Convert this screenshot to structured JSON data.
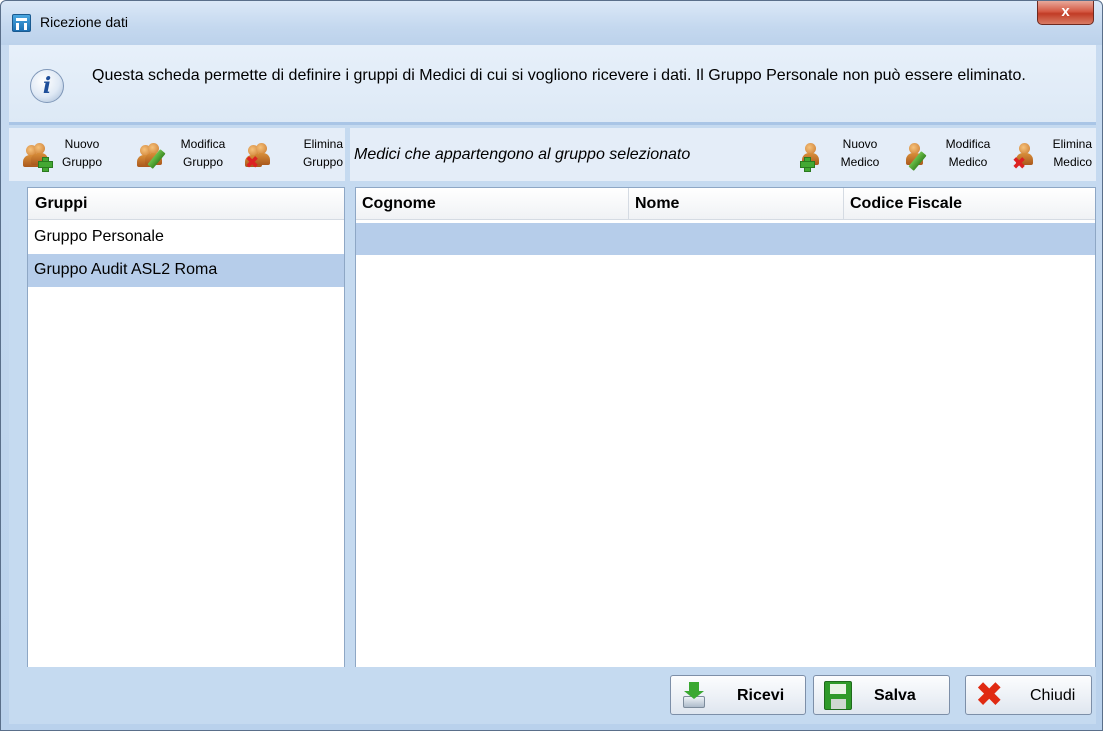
{
  "window": {
    "title": "Ricezione dati",
    "close_label": "x"
  },
  "info": {
    "icon": "info-icon",
    "text": "Questa scheda permette di definire i gruppi di Medici di cui si vogliono ricevere i dati. Il Gruppo Personale non può essere eliminato."
  },
  "group_toolbar": {
    "new": {
      "line1": "Nuovo",
      "line2": "Gruppo",
      "icon": "group-add-icon"
    },
    "edit": {
      "line1": "Modifica",
      "line2": "Gruppo",
      "icon": "group-edit-icon"
    },
    "delete": {
      "line1": "Elimina",
      "line2": "Gruppo",
      "icon": "group-delete-icon"
    }
  },
  "groups": {
    "header": "Gruppi",
    "items": [
      {
        "label": "Gruppo Personale",
        "selected": false
      },
      {
        "label": "Gruppo Audit ASL2 Roma",
        "selected": true
      }
    ]
  },
  "doctors": {
    "title": "Medici che appartengono al gruppo selezionato",
    "toolbar": {
      "new": {
        "line1": "Nuovo",
        "line2": "Medico",
        "icon": "doctor-add-icon"
      },
      "edit": {
        "line1": "Modifica",
        "line2": "Medico",
        "icon": "doctor-edit-icon"
      },
      "delete": {
        "line1": "Elimina",
        "line2": "Medico",
        "icon": "doctor-delete-icon"
      }
    },
    "columns": [
      "Cognome",
      "Nome",
      "Codice Fiscale"
    ],
    "rows": []
  },
  "buttons": {
    "receive": "Ricevi",
    "save": "Salva",
    "close": "Chiudi"
  },
  "colors": {
    "selection": "#b6cdea",
    "frame": "#c5daf0"
  }
}
